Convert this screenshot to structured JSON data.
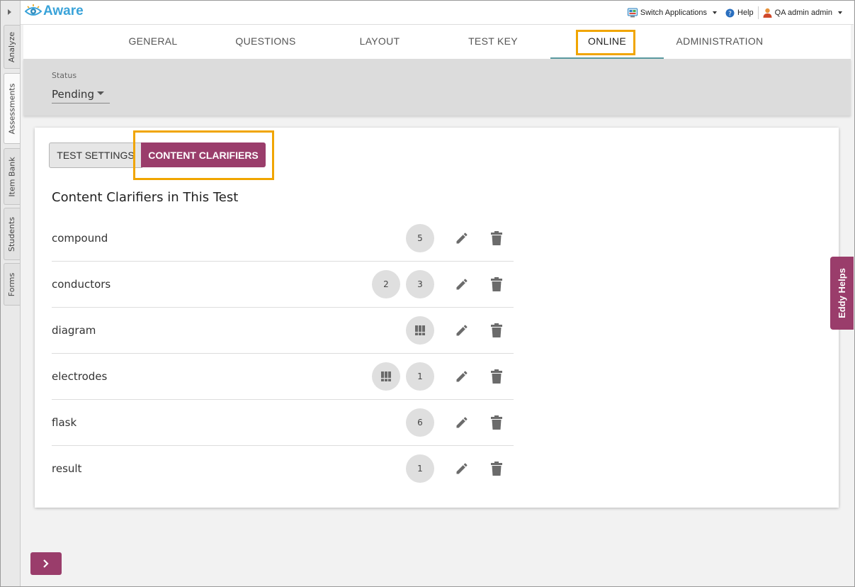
{
  "app": {
    "name": "Aware"
  },
  "header": {
    "switch_apps_label": "Switch Applications",
    "help_label": "Help",
    "user_label": "QA admin admin"
  },
  "left_rail": {
    "tabs": [
      "Analyze",
      "Assessments",
      "Item Bank",
      "Students",
      "Forms"
    ],
    "active": "Assessments"
  },
  "nav": {
    "tabs": [
      "GENERAL",
      "QUESTIONS",
      "LAYOUT",
      "TEST KEY",
      "ONLINE",
      "ADMINISTRATION"
    ],
    "active": "ONLINE"
  },
  "status": {
    "label": "Status",
    "value": "Pending"
  },
  "toggle": {
    "settings_label": "TEST SETTINGS",
    "clarifiers_label": "CONTENT CLARIFIERS",
    "active": "CONTENT CLARIFIERS"
  },
  "section_title": "Content Clarifiers in This Test",
  "clarifiers": [
    {
      "term": "compound",
      "chips": [
        "5"
      ]
    },
    {
      "term": "conductors",
      "chips": [
        "2",
        "3"
      ]
    },
    {
      "term": "diagram",
      "chips": [
        "[book-icon]"
      ]
    },
    {
      "term": "electrodes",
      "chips": [
        "[book-icon]",
        "1"
      ]
    },
    {
      "term": "flask",
      "chips": [
        "6"
      ]
    },
    {
      "term": "result",
      "chips": [
        "1"
      ]
    }
  ],
  "eddy_label": "Eddy Helps",
  "colors": {
    "brand": "#9a3d6b",
    "highlight": "#f0a500",
    "logo": "#3aa3d9"
  }
}
